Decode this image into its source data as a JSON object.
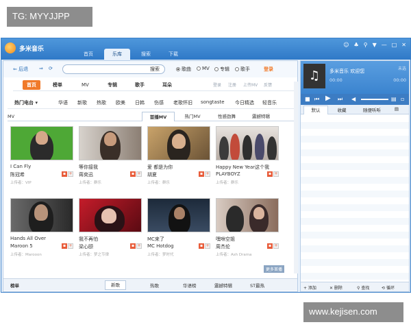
{
  "watermarks": {
    "top_left": "TG: MYYJJPP",
    "bottom_right": "www.kejisen.com"
  },
  "app": {
    "name": "多米音乐"
  },
  "nav": [
    "首页",
    "乐库",
    "搜索",
    "下载"
  ],
  "window_controls": [
    "☺",
    "♣",
    "⚲",
    "▼",
    "—",
    "□",
    "✕"
  ],
  "toolbar": {
    "back": "后退",
    "search_btn": "搜索",
    "radios": [
      "歌曲",
      "MV",
      "专辑",
      "歌手"
    ],
    "login": "登录"
  },
  "categories": [
    "首页",
    "榜单",
    "MV",
    "专辑",
    "歌手",
    "耳朵"
  ],
  "right_links": [
    "登录",
    "注册",
    "上传MV",
    "反馈"
  ],
  "genres": [
    "热门电台",
    "华语",
    "新歌",
    "热歌",
    "欧美",
    "日韩",
    "伤感",
    "老歌怀旧",
    "songtaste",
    "今日精选",
    "轻音乐"
  ],
  "mv_section": {
    "label": "MV",
    "tabs": [
      "首播MV",
      "热门MV",
      "性感劲舞",
      "震撼特辑"
    ]
  },
  "cards": [
    {
      "title": "I Can Fly",
      "artist": "陈冠希",
      "meta": "上传者：VIP"
    },
    {
      "title": "等你接我",
      "artist": "蒋奕迅",
      "meta": "上传者：群乐"
    },
    {
      "title": "爱 都是为你",
      "artist": "胡夏",
      "meta": "上传者：群乐"
    },
    {
      "title": "Happy New Year这个我",
      "artist": "PLAYBOYZ",
      "meta": "上传者：群乐"
    },
    {
      "title": "Hands All Over",
      "artist": "Maroon 5",
      "meta": "上传者：Marooon"
    },
    {
      "title": "我不再怕",
      "artist": "梁心颐",
      "meta": "上传者：梦之节律"
    },
    {
      "title": "MC来了",
      "artist": "MC Hotdog",
      "meta": "上传者：梦时代"
    },
    {
      "title": "嘿咻空姐",
      "artist": "周杰伦",
      "meta": "上传者：Ash Drama"
    }
  ],
  "more_btn": "更多首播",
  "bottom_tabs": {
    "label": "榜单",
    "tabs": [
      "新歌",
      "热歌",
      "华语榜",
      "震撼特辑",
      "ST最热"
    ]
  },
  "player": {
    "title": "多米音乐 欢迎您",
    "time_left": "00:00",
    "time_right": "00:00",
    "quality": "未选"
  },
  "list_tabs": [
    "默认",
    "收藏",
    "随便听听"
  ],
  "list_footer": [
    "+ 添加",
    "✕ 删除",
    "查找",
    "循环"
  ]
}
